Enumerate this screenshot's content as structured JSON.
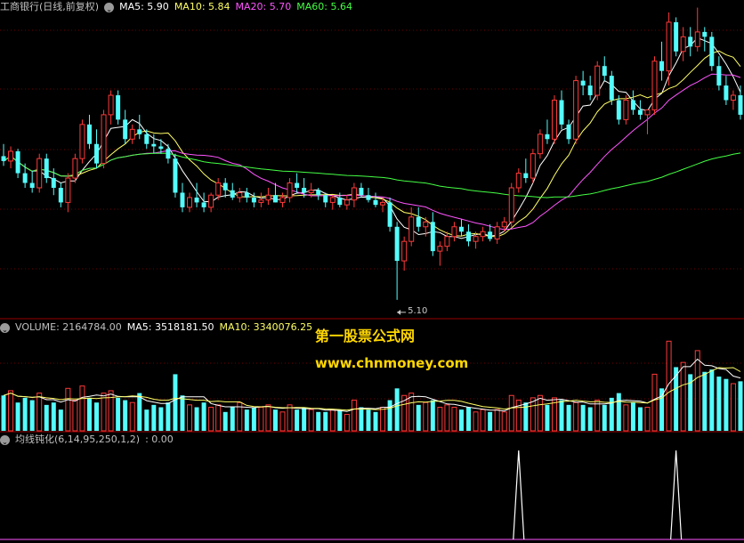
{
  "colors": {
    "background": "#000000",
    "up": "#ff3a3a",
    "down": "#54fcfc",
    "grid": "#6e0000",
    "divider": "#9a0000",
    "ma5": "#ffffff",
    "ma10": "#ffff66",
    "ma20": "#ff55ff",
    "ma60": "#44ff44",
    "vma5": "#ffffff",
    "vma10": "#ffff66",
    "indicator": "#ffffff",
    "watermark": "#ffd700"
  },
  "price_header": {
    "title": "工商银行(日线,前复权)",
    "ma5": "MA5: 5.90",
    "ma10": "MA10: 5.84",
    "ma20": "MA20: 5.70",
    "ma60": "MA60: 5.64"
  },
  "volume_header": {
    "volume": "VOLUME: 2164784.00",
    "ma5": "MA5: 3518181.50",
    "ma10": "MA10: 3340076.25"
  },
  "indicator_header": {
    "name": "均线钝化(6,14,95,250,1,2)",
    "value": ": 0.00"
  },
  "watermark": {
    "line1": "第一股票公式网",
    "line2": "www.chnmoney.com"
  },
  "low_label": "5.10",
  "chart_data": {
    "type": "candlestick",
    "title": "工商银行(日线,前复权)",
    "ylim": [
      5.05,
      6.3
    ],
    "candles": [
      [
        5.71,
        5.76,
        5.67,
        5.69
      ],
      [
        5.69,
        5.75,
        5.66,
        5.73
      ],
      [
        5.73,
        5.74,
        5.62,
        5.64
      ],
      [
        5.64,
        5.68,
        5.58,
        5.6
      ],
      [
        5.6,
        5.65,
        5.56,
        5.58
      ],
      [
        5.58,
        5.72,
        5.56,
        5.7
      ],
      [
        5.7,
        5.72,
        5.6,
        5.62
      ],
      [
        5.62,
        5.66,
        5.55,
        5.58
      ],
      [
        5.58,
        5.6,
        5.5,
        5.52
      ],
      [
        5.52,
        5.64,
        5.48,
        5.62
      ],
      [
        5.62,
        5.72,
        5.6,
        5.7
      ],
      [
        5.7,
        5.86,
        5.68,
        5.84
      ],
      [
        5.84,
        5.88,
        5.74,
        5.76
      ],
      [
        5.76,
        5.82,
        5.66,
        5.68
      ],
      [
        5.68,
        5.9,
        5.66,
        5.88
      ],
      [
        5.88,
        5.98,
        5.84,
        5.96
      ],
      [
        5.96,
        5.98,
        5.84,
        5.86
      ],
      [
        5.86,
        5.9,
        5.76,
        5.78
      ],
      [
        5.78,
        5.84,
        5.76,
        5.82
      ],
      [
        5.82,
        5.88,
        5.78,
        5.8
      ],
      [
        5.8,
        5.82,
        5.74,
        5.76
      ],
      [
        5.76,
        5.8,
        5.72,
        5.75
      ],
      [
        5.75,
        5.78,
        5.72,
        5.74
      ],
      [
        5.74,
        5.76,
        5.68,
        5.7
      ],
      [
        5.7,
        5.72,
        5.54,
        5.56
      ],
      [
        5.56,
        5.6,
        5.48,
        5.5
      ],
      [
        5.5,
        5.56,
        5.48,
        5.54
      ],
      [
        5.54,
        5.6,
        5.5,
        5.52
      ],
      [
        5.52,
        5.56,
        5.48,
        5.5
      ],
      [
        5.5,
        5.56,
        5.48,
        5.55
      ],
      [
        5.55,
        5.62,
        5.53,
        5.6
      ],
      [
        5.6,
        5.62,
        5.54,
        5.57
      ],
      [
        5.57,
        5.6,
        5.53,
        5.54
      ],
      [
        5.54,
        5.58,
        5.52,
        5.56
      ],
      [
        5.56,
        5.58,
        5.52,
        5.54
      ],
      [
        5.54,
        5.56,
        5.5,
        5.52
      ],
      [
        5.52,
        5.56,
        5.5,
        5.53
      ],
      [
        5.53,
        5.58,
        5.51,
        5.55
      ],
      [
        5.55,
        5.6,
        5.52,
        5.52
      ],
      [
        5.52,
        5.56,
        5.5,
        5.54
      ],
      [
        5.54,
        5.62,
        5.52,
        5.6
      ],
      [
        5.6,
        5.64,
        5.56,
        5.58
      ],
      [
        5.58,
        5.62,
        5.54,
        5.56
      ],
      [
        5.56,
        5.6,
        5.54,
        5.57
      ],
      [
        5.57,
        5.58,
        5.53,
        5.55
      ],
      [
        5.55,
        5.56,
        5.5,
        5.52
      ],
      [
        5.52,
        5.55,
        5.49,
        5.54
      ],
      [
        5.54,
        5.56,
        5.5,
        5.51
      ],
      [
        5.51,
        5.55,
        5.49,
        5.53
      ],
      [
        5.53,
        5.6,
        5.5,
        5.58
      ],
      [
        5.58,
        5.6,
        5.54,
        5.55
      ],
      [
        5.55,
        5.58,
        5.52,
        5.53
      ],
      [
        5.53,
        5.56,
        5.5,
        5.51
      ],
      [
        5.51,
        5.54,
        5.48,
        5.52
      ],
      [
        5.52,
        5.54,
        5.4,
        5.42
      ],
      [
        5.42,
        5.44,
        5.12,
        5.28
      ],
      [
        5.28,
        5.38,
        5.24,
        5.36
      ],
      [
        5.36,
        5.5,
        5.34,
        5.46
      ],
      [
        5.46,
        5.5,
        5.4,
        5.42
      ],
      [
        5.42,
        5.46,
        5.38,
        5.44
      ],
      [
        5.44,
        5.48,
        5.3,
        5.32
      ],
      [
        5.32,
        5.36,
        5.26,
        5.34
      ],
      [
        5.34,
        5.4,
        5.32,
        5.38
      ],
      [
        5.38,
        5.44,
        5.36,
        5.42
      ],
      [
        5.42,
        5.45,
        5.38,
        5.4
      ],
      [
        5.4,
        5.43,
        5.34,
        5.36
      ],
      [
        5.36,
        5.4,
        5.33,
        5.38
      ],
      [
        5.38,
        5.42,
        5.36,
        5.4
      ],
      [
        5.4,
        5.43,
        5.36,
        5.37
      ],
      [
        5.37,
        5.44,
        5.35,
        5.42
      ],
      [
        5.42,
        5.46,
        5.4,
        5.44
      ],
      [
        5.44,
        5.6,
        5.42,
        5.58
      ],
      [
        5.58,
        5.66,
        5.56,
        5.64
      ],
      [
        5.64,
        5.7,
        5.6,
        5.62
      ],
      [
        5.62,
        5.74,
        5.6,
        5.72
      ],
      [
        5.72,
        5.82,
        5.7,
        5.8
      ],
      [
        5.8,
        5.86,
        5.76,
        5.78
      ],
      [
        5.78,
        5.96,
        5.76,
        5.94
      ],
      [
        5.94,
        5.98,
        5.82,
        5.84
      ],
      [
        5.84,
        5.86,
        5.76,
        5.78
      ],
      [
        5.78,
        6.04,
        5.76,
        6.02
      ],
      [
        6.02,
        6.06,
        5.96,
        6.0
      ],
      [
        6.0,
        6.04,
        5.94,
        5.96
      ],
      [
        5.96,
        6.1,
        5.94,
        6.08
      ],
      [
        6.08,
        6.12,
        6.02,
        6.04
      ],
      [
        6.04,
        6.06,
        5.92,
        5.94
      ],
      [
        5.94,
        5.96,
        5.84,
        5.86
      ],
      [
        5.86,
        5.96,
        5.84,
        5.94
      ],
      [
        5.94,
        5.98,
        5.88,
        5.9
      ],
      [
        5.9,
        5.94,
        5.86,
        5.88
      ],
      [
        5.88,
        5.9,
        5.8,
        5.9
      ],
      [
        5.9,
        6.12,
        5.88,
        6.1
      ],
      [
        6.1,
        6.18,
        6.02,
        6.06
      ],
      [
        6.06,
        6.3,
        6.0,
        6.26
      ],
      [
        6.26,
        6.28,
        6.12,
        6.14
      ],
      [
        6.14,
        6.24,
        6.1,
        6.2
      ],
      [
        6.2,
        6.24,
        6.12,
        6.16
      ],
      [
        6.16,
        6.32,
        6.14,
        6.22
      ],
      [
        6.22,
        6.24,
        6.14,
        6.2
      ],
      [
        6.2,
        6.22,
        6.06,
        6.08
      ],
      [
        6.08,
        6.12,
        5.98,
        6.0
      ],
      [
        6.0,
        6.04,
        5.92,
        5.94
      ],
      [
        5.94,
        5.98,
        5.9,
        5.96
      ],
      [
        5.96,
        6.0,
        5.86,
        5.88
      ]
    ],
    "ma5": "MA5: 5.90",
    "ma10": "MA10: 5.84",
    "ma20": "MA20: 5.70",
    "ma60": "MA60: 5.64",
    "low_marker": {
      "index": 55,
      "value": 5.1
    },
    "volume": {
      "ylim": [
        0,
        4000000
      ],
      "values": [
        1500000,
        1700000,
        1200000,
        1400000,
        1300000,
        1600000,
        1100000,
        1200000,
        900000,
        1800000,
        1300000,
        1900000,
        1400000,
        1200000,
        1600000,
        1700000,
        1400000,
        1300000,
        1200000,
        1600000,
        900000,
        1100000,
        1000000,
        1200000,
        2400000,
        1500000,
        1100000,
        1000000,
        1200000,
        1000000,
        1100000,
        800000,
        1000000,
        1200000,
        900000,
        1000000,
        1000000,
        1100000,
        900000,
        800000,
        1100000,
        900000,
        1000000,
        900000,
        800000,
        800000,
        900000,
        900000,
        700000,
        1300000,
        1000000,
        900000,
        800000,
        1000000,
        1300000,
        1800000,
        1500000,
        1600000,
        1100000,
        1200000,
        1300000,
        1000000,
        1100000,
        1000000,
        900000,
        1000000,
        800000,
        900000,
        800000,
        900000,
        800000,
        1500000,
        1300000,
        1200000,
        1400000,
        1500000,
        1100000,
        1400000,
        1300000,
        1100000,
        1200000,
        1100000,
        1000000,
        1300000,
        1100000,
        1400000,
        1600000,
        1100000,
        1200000,
        1000000,
        1000000,
        2400000,
        1800000,
        3800000,
        2700000,
        2900000,
        2400000,
        3400000,
        2500000,
        2600000,
        2300000,
        2200000,
        2000000,
        2100000
      ],
      "up_flags_from_candles": true
    },
    "indicator": {
      "name": "均线钝化(6,14,95,250,1,2)",
      "value": ": 0.00",
      "ylim": [
        0,
        1
      ],
      "spikes": [
        72,
        94
      ]
    }
  }
}
